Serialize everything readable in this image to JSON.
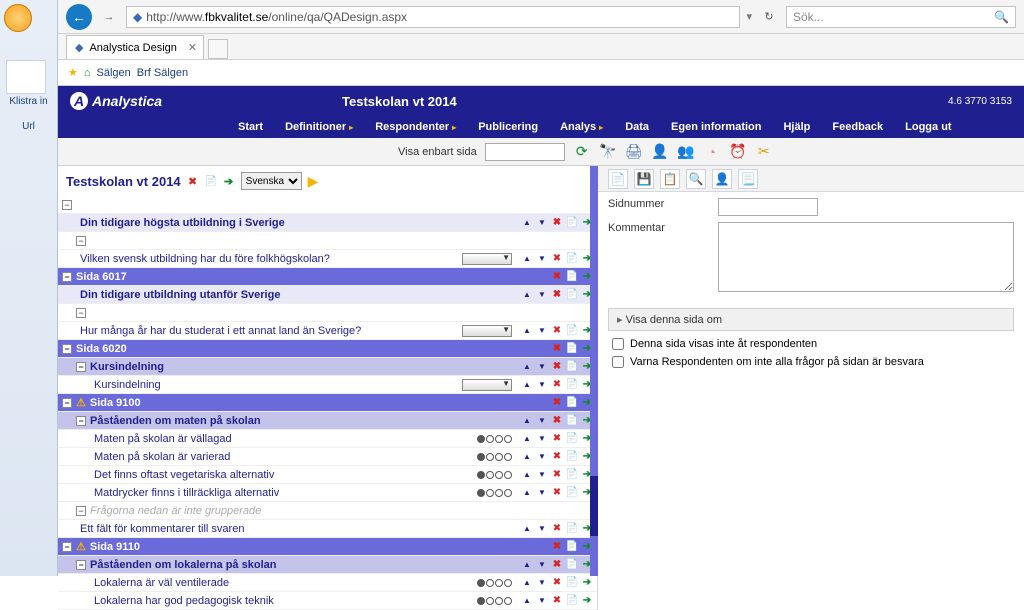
{
  "office": {
    "paste_label": "Klistra in",
    "url_tip": "Url"
  },
  "browser": {
    "url_prefix": "http://www.",
    "url_host": "fbkvalitet.se",
    "url_path": "/online/qa/QADesign.aspx",
    "tab_title": "Analystica Design",
    "search_placeholder": "Sök...",
    "fav1": "Sälgen",
    "fav2": "Brf Sälgen"
  },
  "app": {
    "brand": "Analystica",
    "title": "Testskolan vt 2014",
    "version": "4.6 3770 3153"
  },
  "menu": {
    "start": "Start",
    "definitioner": "Definitioner",
    "respondenter": "Respondenter",
    "publicering": "Publicering",
    "analys": "Analys",
    "data": "Data",
    "egen": "Egen information",
    "hjalp": "Hjälp",
    "feedback": "Feedback",
    "logga_ut": "Logga ut"
  },
  "toolbar": {
    "visa_enbart": "Visa enbart sida"
  },
  "survey": {
    "title": "Testskolan vt 2014",
    "lang": "Svenska",
    "rows": [
      {
        "type": "heading",
        "text": "Din tidigare högsta utbildning i Sverige"
      },
      {
        "type": "item",
        "text": "Vilken svensk utbildning har du före folkhögskolan?",
        "ctrl": "dd"
      },
      {
        "type": "pagebar",
        "text": "Sida 6017"
      },
      {
        "type": "heading",
        "text": "Din tidigare utbildning utanför Sverige"
      },
      {
        "type": "item",
        "text": "Hur många år har du studerat i ett annat land än Sverige?",
        "ctrl": "dd"
      },
      {
        "type": "pagebar",
        "text": "Sida 6020"
      },
      {
        "type": "groupbar",
        "text": "Kursindelning"
      },
      {
        "type": "item",
        "text": "Kursindelning",
        "ctrl": "dd",
        "indent": 2
      },
      {
        "type": "pagebar",
        "text": "Sida 9100",
        "warn": true
      },
      {
        "type": "groupbar",
        "text": "Påståenden om maten på skolan"
      },
      {
        "type": "item",
        "text": "Maten på skolan är vällagad",
        "ctrl": "scale",
        "indent": 2
      },
      {
        "type": "item",
        "text": "Maten på skolan är varierad",
        "ctrl": "scale",
        "indent": 2
      },
      {
        "type": "item",
        "text": "Det finns oftast vegetariska alternativ",
        "ctrl": "scale",
        "indent": 2
      },
      {
        "type": "item",
        "text": "Matdrycker finns i tillräckliga alternativ",
        "ctrl": "scale",
        "indent": 2
      },
      {
        "type": "ghost",
        "text": "Frågorna nedan är inte grupperade"
      },
      {
        "type": "item",
        "text": "Ett fält för kommentarer till svaren",
        "ctrl": "none"
      },
      {
        "type": "pagebar",
        "text": "Sida 9110",
        "warn": true
      },
      {
        "type": "groupbar",
        "text": "Påståenden om lokalerna på skolan"
      },
      {
        "type": "item",
        "text": "Lokalerna är väl ventilerade",
        "ctrl": "scale",
        "indent": 2
      },
      {
        "type": "item",
        "text": "Lokalerna har god pedagogisk teknik",
        "ctrl": "scale",
        "indent": 2
      }
    ]
  },
  "props": {
    "sidnummer": "Sidnummer",
    "kommentar": "Kommentar",
    "visa_denna": "Visa denna sida om",
    "chk1": "Denna sida visas inte åt respondenten",
    "chk2": "Varna Respondenten om inte alla frågor på sidan är besvara"
  }
}
